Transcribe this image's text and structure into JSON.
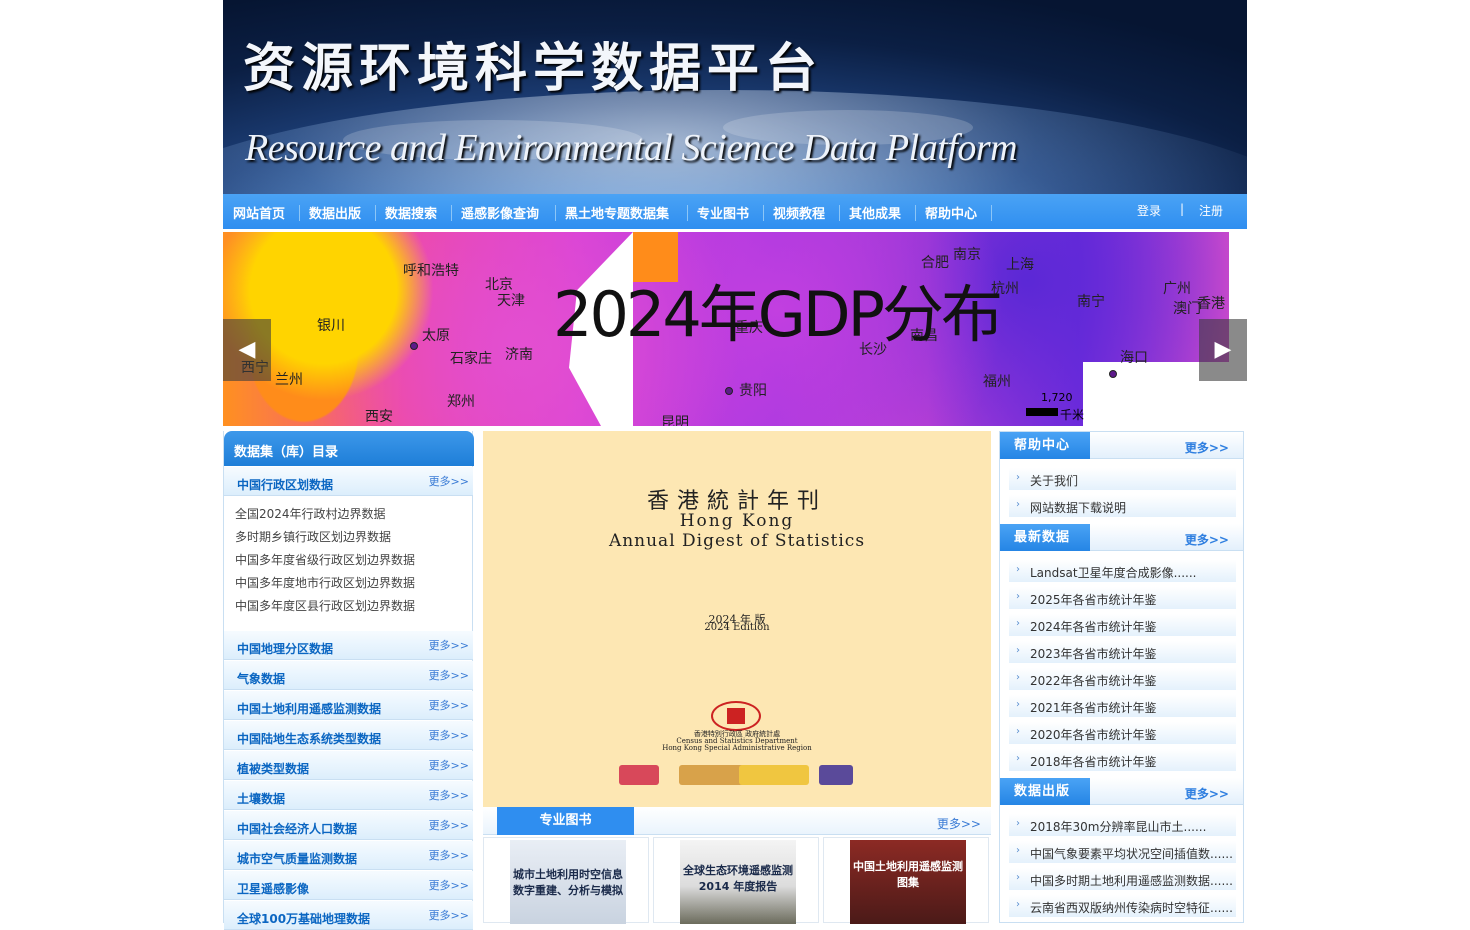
{
  "header": {
    "title_cn": "资源环境科学数据平台",
    "title_en": "Resource and Environmental Science Data Platform"
  },
  "nav": {
    "items": [
      "网站首页",
      "数据出版",
      "数据搜索",
      "遥感影像查询",
      "黑土地专题数据集",
      "专业图书",
      "视频教程",
      "其他成果",
      "帮助中心"
    ],
    "login": "登录",
    "divider": "|",
    "register": "注册"
  },
  "slider": {
    "caption": "2024年GDP分布",
    "prev_icon": "arrow-left-icon",
    "next_icon": "arrow-right-icon",
    "cities": [
      "呼和浩特",
      "北京",
      "天津",
      "银川",
      "太原",
      "石家庄",
      "济南",
      "西宁",
      "兰州",
      "郑州",
      "西安",
      "合肥",
      "南京",
      "上海",
      "杭州",
      "重庆",
      "南宁",
      "广州",
      "香港",
      "澳门",
      "南昌",
      "长沙",
      "海口",
      "贵阳",
      "福州",
      "昆明"
    ],
    "scale_value": "1,720",
    "scale_unit": "千米"
  },
  "catalog": {
    "title": "数据集（库）目录",
    "more": "更多>>",
    "categories": [
      {
        "name": "中国行政区划数据",
        "items": [
          "全国2024年行政村边界数据",
          "多时期乡镇行政区划边界数据",
          "中国多年度省级行政区划边界数据",
          "中国多年度地市行政区划边界数据",
          "中国多年度区县行政区划边界数据"
        ]
      },
      {
        "name": "中国地理分区数据"
      },
      {
        "name": "气象数据"
      },
      {
        "name": "中国土地利用遥感监测数据"
      },
      {
        "name": "中国陆地生态系统类型数据"
      },
      {
        "name": "植被类型数据"
      },
      {
        "name": "土壤数据"
      },
      {
        "name": "中国社会经济人口数据"
      },
      {
        "name": "城市空气质量监测数据"
      },
      {
        "name": "卫星遥感影像"
      },
      {
        "name": "全球100万基础地理数据"
      }
    ]
  },
  "feature_book": {
    "title_cn": "香港統計年刊",
    "title_en1": "Hong Kong",
    "title_en2": "Annual Digest of Statistics",
    "edition_cn": "2024 年 版",
    "edition_en": "2024 Edition",
    "publisher_cn": "香港特別行政區 政府統計處",
    "publisher_en1": "Census and Statistics Department",
    "publisher_en2": "Hong Kong Special Administrative Region"
  },
  "books": {
    "tab": "专业图书",
    "more": "更多>>",
    "items": [
      {
        "cover_title": "城市土地利用时空信息数字重建、分析与模拟"
      },
      {
        "cover_title": "全球生态环境遥感监测 2014 年度报告"
      },
      {
        "cover_title": "中国土地利用遥感监测图集"
      }
    ]
  },
  "help": {
    "title": "帮助中心",
    "more": "更多>>",
    "items": [
      "关于我们",
      "网站数据下载说明"
    ]
  },
  "latest": {
    "title": "最新数据",
    "more": "更多>>",
    "items": [
      "Landsat卫星年度合成影像......",
      "2025年各省市统计年鉴",
      "2024年各省市统计年鉴",
      "2023年各省市统计年鉴",
      "2022年各省市统计年鉴",
      "2021年各省市统计年鉴",
      "2020年各省市统计年鉴",
      "2018年各省市统计年鉴"
    ]
  },
  "publish": {
    "title": "数据出版",
    "more": "更多>>",
    "items": [
      "2018年30m分辨率昆山市土......",
      "中国气象要素平均状况空间插值数......",
      "中国多时期土地利用遥感监测数据......",
      "云南省西双版纳州传染病时空特征......"
    ]
  }
}
